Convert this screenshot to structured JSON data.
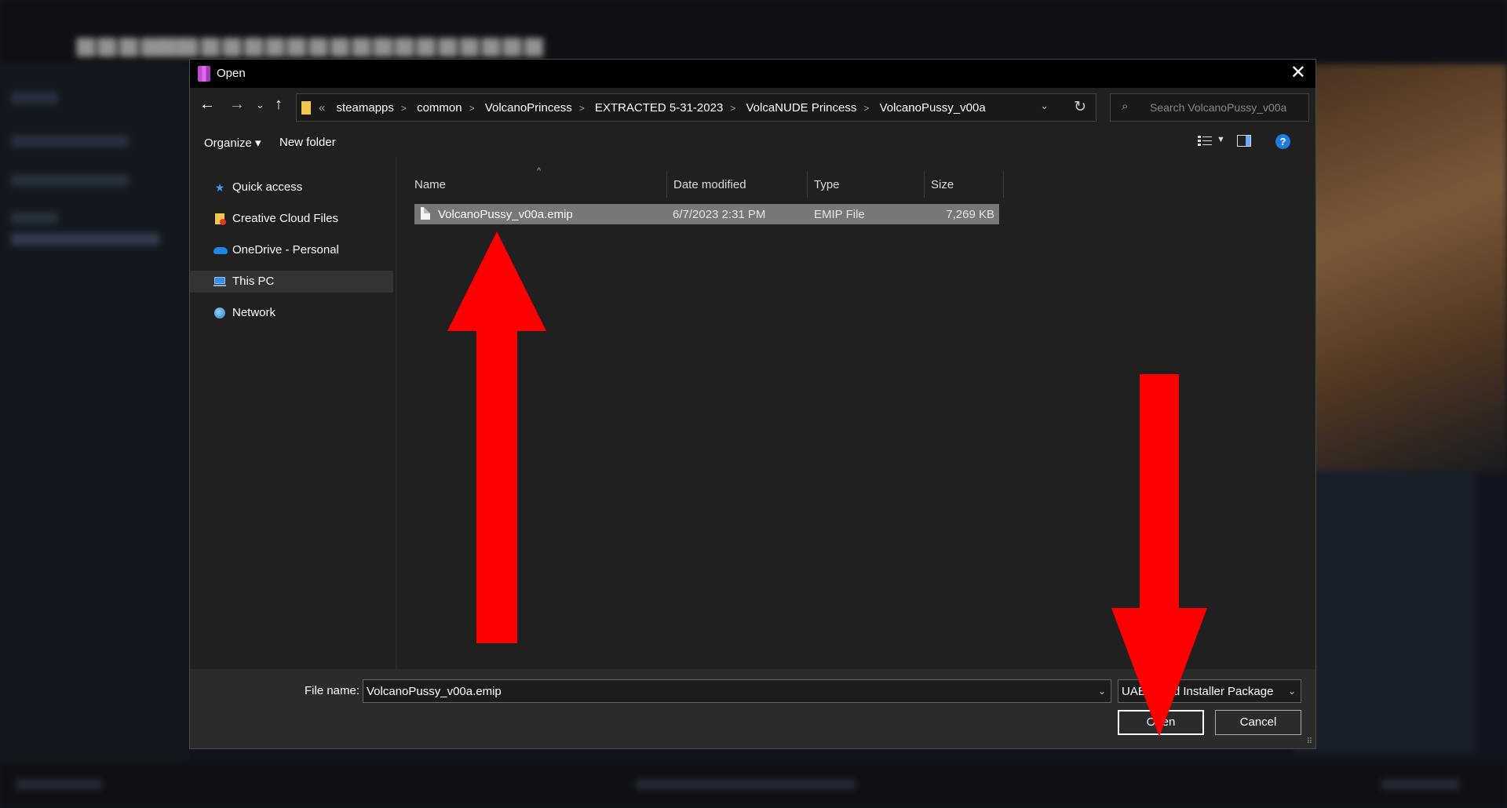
{
  "dialog": {
    "title": "Open",
    "close": "✕",
    "address": {
      "overflow": "«",
      "crumbs": [
        "steamapps",
        "common",
        "VolcanoPrincess",
        "EXTRACTED 5-31-2023",
        "VolcaNUDE Princess",
        "VolcanoPussy_v00a"
      ]
    },
    "search_placeholder": "Search VolcanoPussy_v00a",
    "toolbar": {
      "organize": "Organize ▾",
      "new_folder": "New folder",
      "help": "?"
    },
    "nav": [
      {
        "label": "Quick access",
        "icon": "star-icon"
      },
      {
        "label": "Creative Cloud Files",
        "icon": "creative-cloud-icon"
      },
      {
        "label": "OneDrive - Personal",
        "icon": "onedrive-icon"
      },
      {
        "label": "This PC",
        "icon": "pc-icon"
      },
      {
        "label": "Network",
        "icon": "network-icon"
      }
    ],
    "columns": {
      "name": "Name",
      "date": "Date modified",
      "type": "Type",
      "size": "Size"
    },
    "files": [
      {
        "name": "VolcanoPussy_v00a.emip",
        "date": "6/7/2023 2:31 PM",
        "type": "EMIP File",
        "size": "7,269 KB"
      }
    ],
    "footer": {
      "file_name_label": "File name:",
      "file_name_value": "VolcanoPussy_v00a.emip",
      "file_type": "UABE Mod Installer Package (*.emip)",
      "open": "Open",
      "cancel": "Cancel"
    }
  },
  "colors": {
    "arrow": "#ff0000",
    "selection": "#777777",
    "accent": "#1e7be0"
  }
}
